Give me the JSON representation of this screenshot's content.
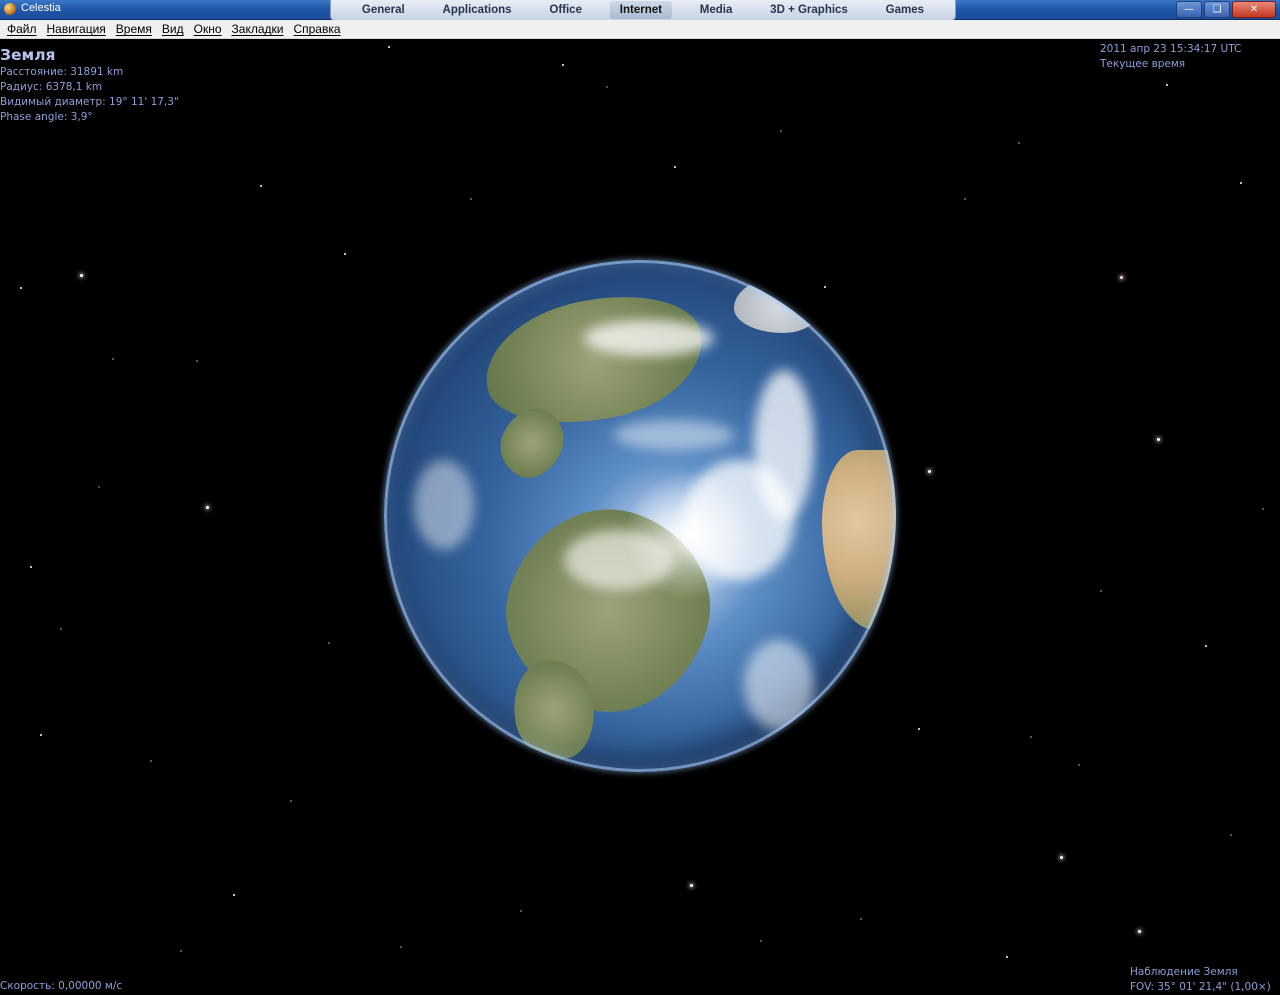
{
  "window": {
    "title": "Celestia",
    "controls": {
      "minimize": "minimize-icon",
      "maximize": "maximize-icon",
      "close": "close-icon"
    }
  },
  "launcher": {
    "tabs": [
      {
        "label": "General",
        "active": false
      },
      {
        "label": "Applications",
        "active": false
      },
      {
        "label": "Office",
        "active": false
      },
      {
        "label": "Internet",
        "active": true
      },
      {
        "label": "Media",
        "active": false
      },
      {
        "label": "3D + Graphics",
        "active": false
      },
      {
        "label": "Games",
        "active": false
      }
    ]
  },
  "menu": {
    "items": [
      "Файл",
      "Навигация",
      "Время",
      "Вид",
      "Окно",
      "Закладки",
      "Справка"
    ]
  },
  "info": {
    "object_name": "Земля",
    "distance": "Расстояние: 31891 km",
    "radius": "Радиус: 6378,1 km",
    "apparent_diameter": "Видимый диаметр: 19° 11' 17,3\"",
    "phase_angle": "Phase angle: 3,9°"
  },
  "time": {
    "datetime": "2011 апр 23 15:34:17 UTC",
    "mode": "Текущее время"
  },
  "status": {
    "speed": "Скорость: 0,00000 м/с",
    "observation": "Наблюдение Земля",
    "fov": "FOV: 35° 01' 21,4\" (1,00×)"
  },
  "colors": {
    "hud_text": "#8f9fd8",
    "space_background": "#000000",
    "titlebar": "#1f56a8"
  }
}
